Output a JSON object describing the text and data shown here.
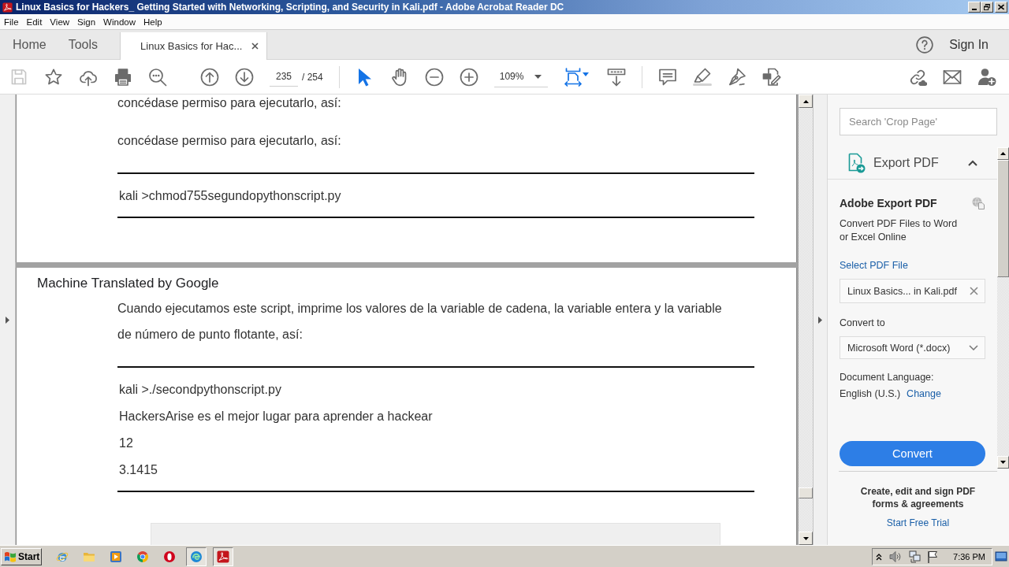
{
  "window": {
    "title": "Linux Basics for Hackers_ Getting Started with Networking, Scripting, and Security in Kali.pdf - Adobe Acrobat Reader DC"
  },
  "menu": [
    "File",
    "Edit",
    "View",
    "Sign",
    "Window",
    "Help"
  ],
  "tabs": [
    {
      "label": "Home",
      "kind": "nav",
      "selected": false
    },
    {
      "label": "Tools",
      "kind": "nav",
      "selected": false
    },
    {
      "label": "Linux Basics for Hac...",
      "kind": "document",
      "selected": true
    }
  ],
  "account": {
    "sign_in": "Sign In"
  },
  "toolbar": {
    "file_tools": [
      {
        "kind": "save",
        "disabled": true
      },
      {
        "kind": "bookmark",
        "disabled": false
      },
      {
        "kind": "upload",
        "disabled": false
      },
      {
        "kind": "print",
        "disabled": false
      },
      {
        "kind": "find",
        "disabled": false
      }
    ],
    "page_nav": [
      {
        "kind": "previous"
      },
      {
        "kind": "next"
      }
    ],
    "page_field": {
      "value": "235"
    },
    "page_total": "/ 254",
    "pointer_tools": [
      {
        "kind": "select",
        "selected": true
      },
      {
        "kind": "hand",
        "selected": false
      }
    ],
    "zoom_buttons": [
      {
        "kind": "zoom_out"
      },
      {
        "kind": "zoom_in"
      }
    ],
    "zoom_field": {
      "value": "109%"
    },
    "view_tools": [
      {
        "kind": "fit"
      },
      {
        "kind": "scroll"
      }
    ],
    "annotate_tools": [
      {
        "kind": "comment"
      },
      {
        "kind": "highlight"
      },
      {
        "kind": "draw"
      },
      {
        "kind": "fill_sign"
      }
    ],
    "share_tools": [
      {
        "kind": "link"
      },
      {
        "kind": "email"
      },
      {
        "kind": "add_user"
      }
    ]
  },
  "document": {
    "pages": [
      {
        "blocks": [
          {
            "kind": "paragraph",
            "text": "concédase permiso para ejecutarlo, así:"
          },
          {
            "kind": "paragraph",
            "text": "concédase permiso para ejecutarlo, así:"
          },
          {
            "kind": "code",
            "lines": [
              "kali >chmod755segundopythonscript.py"
            ]
          }
        ]
      },
      {
        "blocks": [
          {
            "kind": "header",
            "text": "Machine Translated by Google"
          },
          {
            "kind": "paragraph",
            "text": "Cuando ejecutamos este script, imprime los valores de la variable de cadena, la variable entera y la variable de número de punto flotante, así:"
          },
          {
            "kind": "code",
            "lines": [
              "kali >./secondpythonscript.py",
              "HackersArise es el mejor lugar para aprender a hackear",
              "12",
              "3.1415"
            ]
          },
          {
            "kind": "image"
          }
        ]
      }
    ]
  },
  "right_panel": {
    "search": {
      "placeholder": "Search 'Crop Page'"
    },
    "section": {
      "title": "Export PDF",
      "expanded": true
    },
    "heading": "Adobe Export PDF",
    "description": "Convert PDF Files to Word or Excel Online",
    "select_link": "Select PDF File",
    "file_field": {
      "value": "Linux Basics... in Kali.pdf"
    },
    "convert_to_label": "Convert to",
    "format_dropdown": {
      "value": "Microsoft Word (*.docx)"
    },
    "language_label": "Document Language:",
    "language": "English (U.S.)",
    "change_link": "Change",
    "convert_button": "Convert",
    "promo": {
      "text": "Create, edit and sign PDF forms & agreements",
      "link": "Start Free Trial"
    }
  },
  "taskbar": {
    "start": "Start",
    "apps": [
      {
        "kind": "ie",
        "selected": false
      },
      {
        "kind": "explorer",
        "selected": false
      },
      {
        "kind": "media",
        "selected": false
      },
      {
        "kind": "chrome",
        "selected": false
      },
      {
        "kind": "opera",
        "selected": false
      },
      {
        "kind": "edge",
        "selected": true
      },
      {
        "kind": "acrobat",
        "selected": true
      }
    ],
    "time": "7:36 PM"
  }
}
